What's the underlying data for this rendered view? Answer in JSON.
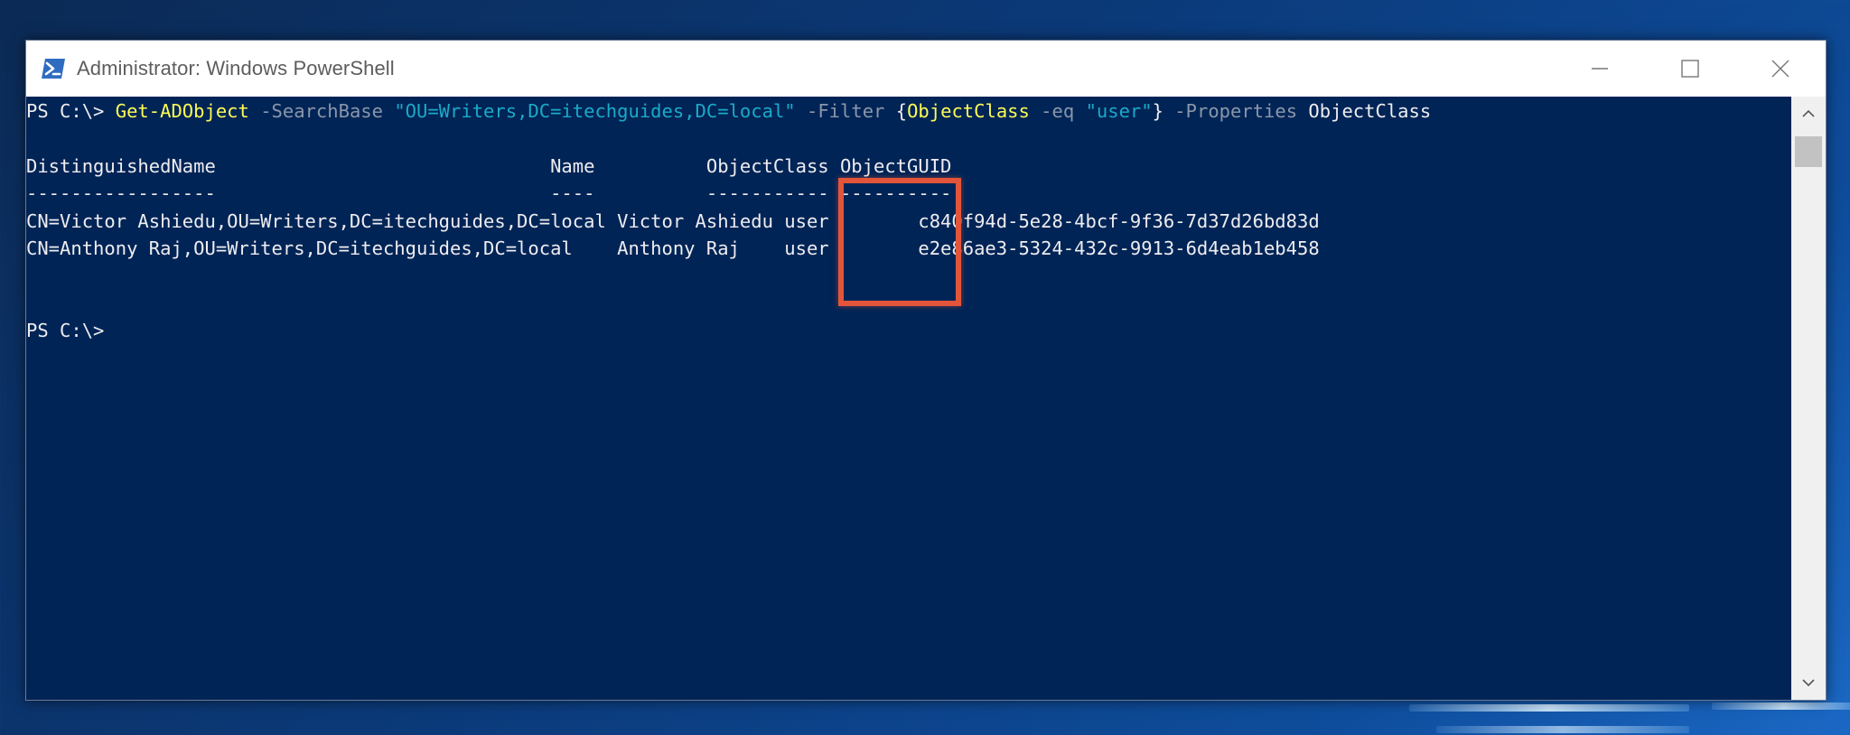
{
  "window": {
    "title": "Administrator: Windows PowerShell"
  },
  "console": {
    "prompt_line": {
      "prompt": "PS C:\\> ",
      "cmdlet": "Get-ADObject",
      "param1": " -SearchBase ",
      "searchbase_value": "\"OU=Writers,DC=itechguides,DC=local\"",
      "param2": " -Filter ",
      "brace_open": "{",
      "filter_property": "ObjectClass",
      "filter_operator": " -eq ",
      "filter_value": "\"user\"",
      "brace_close": "}",
      "param3": " -Properties ",
      "properties_value": "ObjectClass"
    },
    "table": {
      "header_line": "DistinguishedName                              Name          ObjectClass ObjectGUID",
      "separator_line": "-----------------                              ----          ----------- ----------",
      "rows": [
        "CN=Victor Ashiedu,OU=Writers,DC=itechguides,DC=local Victor Ashiedu user        c840f94d-5e28-4bcf-9f36-7d37d26bd83d",
        "CN=Anthony Raj,OU=Writers,DC=itechguides,DC=local    Anthony Raj    user        e2e86ae3-5324-432c-9913-6d4eab1eb458"
      ]
    },
    "final_prompt": "PS C:\\>"
  },
  "colors": {
    "console_background": "#012456",
    "cmdlet": "#fcfc54",
    "parameter": "#8a97aa",
    "string": "#1aaac9",
    "text": "#eeedf0",
    "highlight_box": "#e2553a"
  },
  "icons": {
    "app": "powershell-icon",
    "minimize": "minimize-icon",
    "maximize": "maximize-icon",
    "close": "close-icon",
    "scroll_up": "chevron-up-icon",
    "scroll_down": "chevron-down-icon"
  }
}
